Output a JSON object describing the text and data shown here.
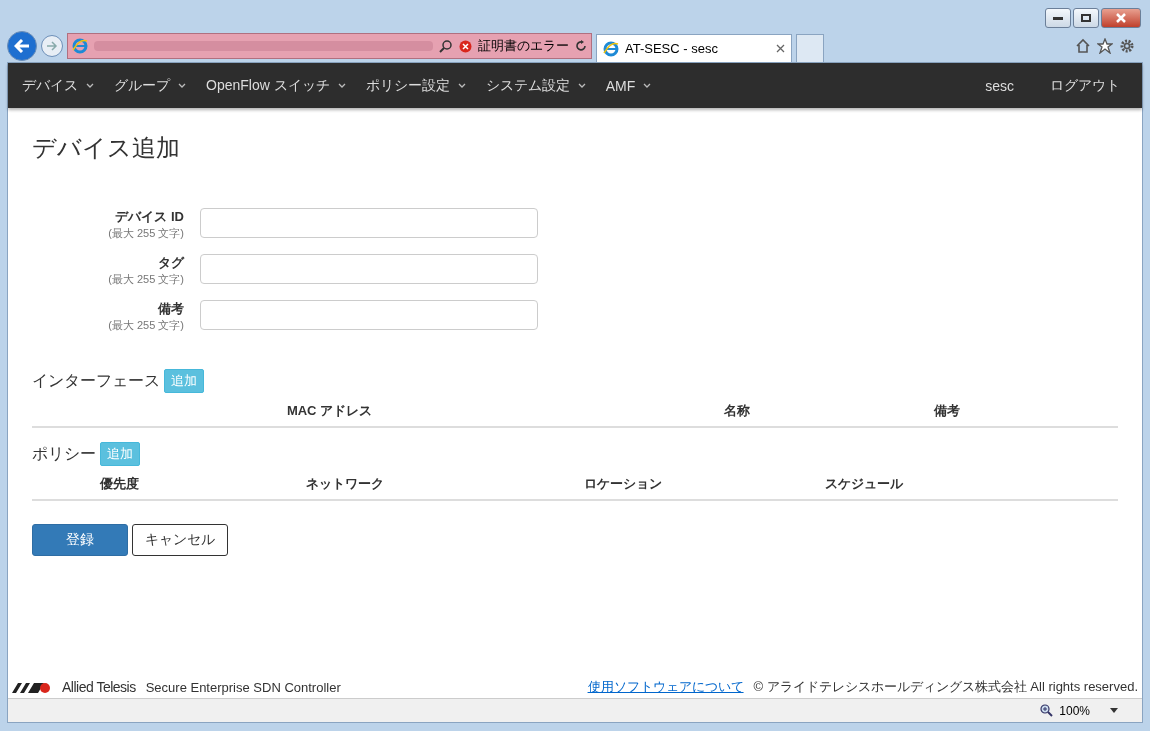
{
  "browser": {
    "address_status": "証明書のエラー",
    "tabs": [
      {
        "label": "AT-SESC - sesc",
        "selected": true
      }
    ],
    "zoom": "100%"
  },
  "nav": {
    "menus": [
      {
        "label": "デバイス"
      },
      {
        "label": "グループ"
      },
      {
        "label": "OpenFlow スイッチ"
      },
      {
        "label": "ポリシー設定"
      },
      {
        "label": "システム設定"
      },
      {
        "label": "AMF"
      }
    ],
    "user": "sesc",
    "logout": "ログアウト"
  },
  "page": {
    "title": "デバイス追加",
    "fields": [
      {
        "label": "デバイス ID",
        "hint": "(最大 255 文字)"
      },
      {
        "label": "タグ",
        "hint": "(最大 255 文字)"
      },
      {
        "label": "備考",
        "hint": "(最大 255 文字)"
      }
    ],
    "sections": [
      {
        "title": "インターフェース",
        "add": "追加",
        "columns": [
          "MAC アドレス",
          "名称",
          "備考"
        ]
      },
      {
        "title": "ポリシー",
        "add": "追加",
        "columns": [
          "優先度",
          "ネットワーク",
          "ロケーション",
          "スケジュール"
        ]
      }
    ],
    "buttons": [
      {
        "label": "登録",
        "kind": "primary"
      },
      {
        "label": "キャンセル",
        "kind": "default"
      }
    ]
  },
  "footer": {
    "brand": "Allied Telesis",
    "product": "Secure Enterprise SDN Controller",
    "link": "使用ソフトウェアについて",
    "copyright": "© アライドテレシスホールディングス株式会社 All rights reserved."
  }
}
